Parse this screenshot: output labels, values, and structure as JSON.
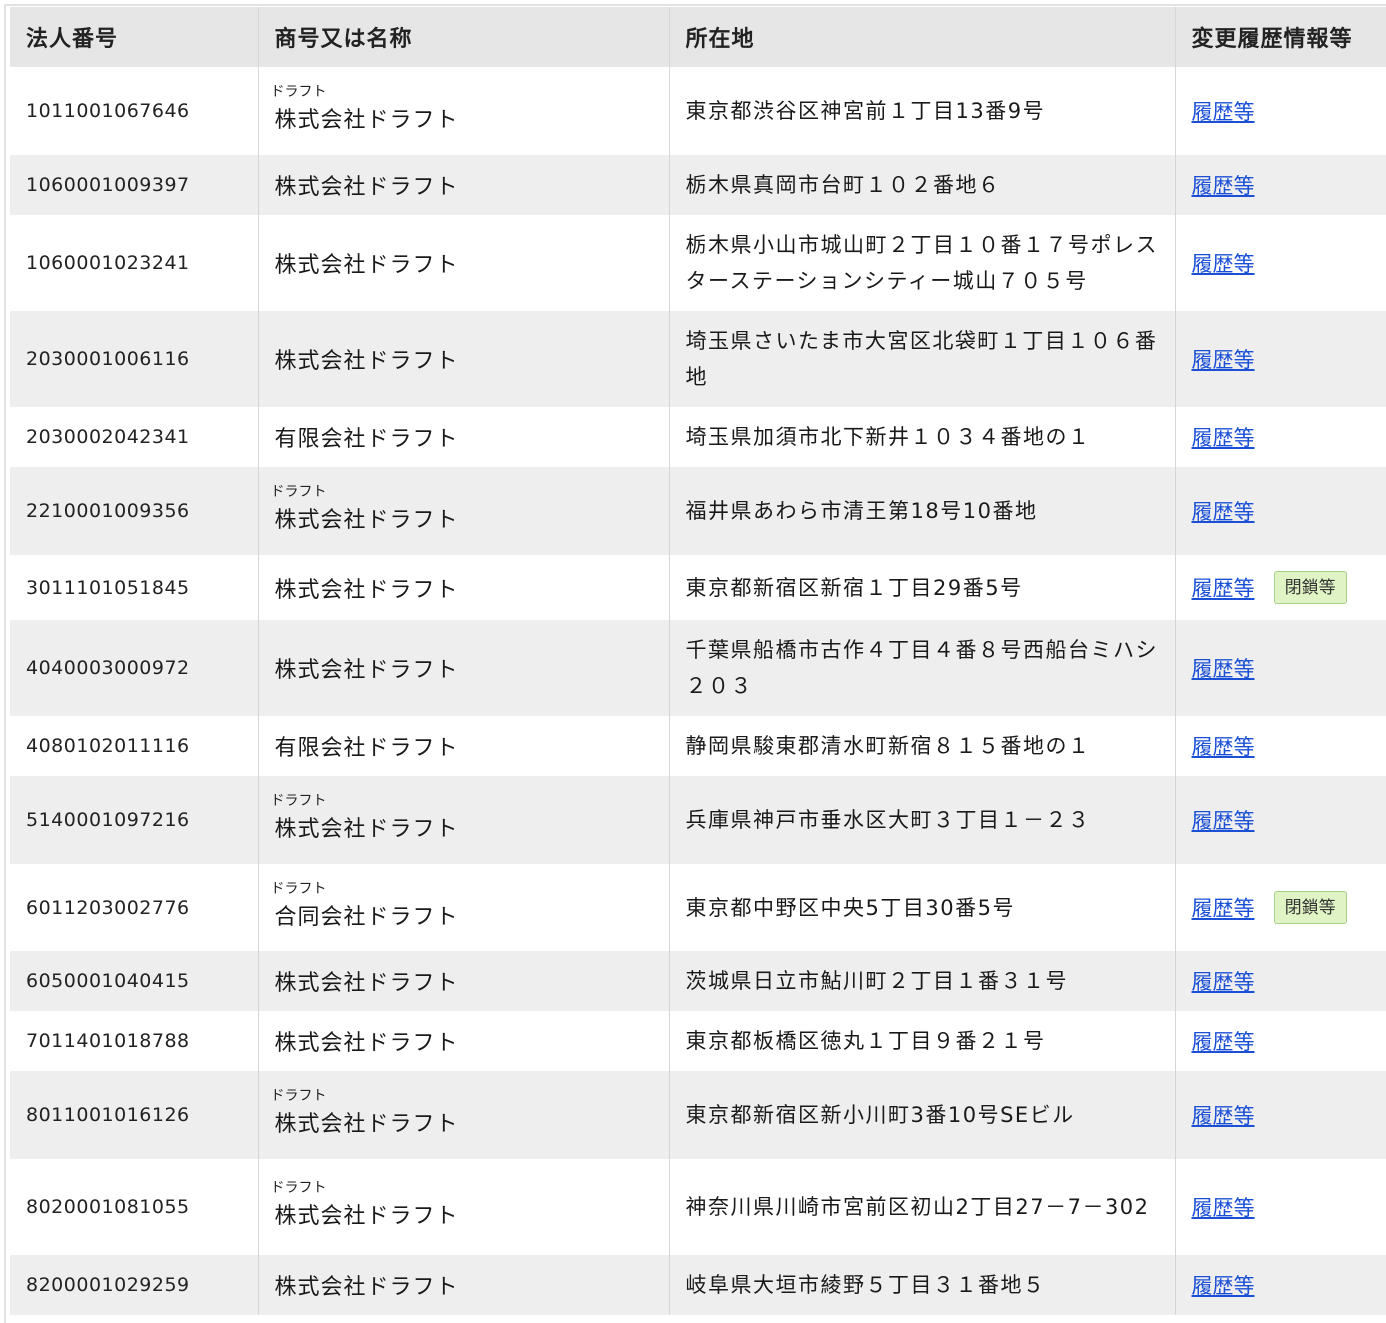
{
  "headers": {
    "corp_number": "法人番号",
    "name": "商号又は名称",
    "address": "所在地",
    "history": "変更履歴情報等"
  },
  "history_link_label": "履歴等",
  "closed_label": "閉鎖等",
  "rows": [
    {
      "number": "1011001067646",
      "furigana": "ドラフト",
      "name": "株式会社ドラフト",
      "address": "東京都渋谷区神宮前１丁目13番9号",
      "closed": false
    },
    {
      "number": "1060001009397",
      "furigana": "",
      "name": "株式会社ドラフト",
      "address": "栃木県真岡市台町１０２番地６",
      "closed": false
    },
    {
      "number": "1060001023241",
      "furigana": "",
      "name": "株式会社ドラフト",
      "address": "栃木県小山市城山町２丁目１０番１７号ポレスターステーションシティー城山７０５号",
      "closed": false
    },
    {
      "number": "2030001006116",
      "furigana": "",
      "name": "株式会社ドラフト",
      "address": "埼玉県さいたま市大宮区北袋町１丁目１０６番地",
      "closed": false
    },
    {
      "number": "2030002042341",
      "furigana": "",
      "name": "有限会社ドラフト",
      "address": "埼玉県加須市北下新井１０３４番地の１",
      "closed": false
    },
    {
      "number": "2210001009356",
      "furigana": "ドラフト",
      "name": "株式会社ドラフト",
      "address": "福井県あわら市清王第18号10番地",
      "closed": false
    },
    {
      "number": "3011101051845",
      "furigana": "",
      "name": "株式会社ドラフト",
      "address": "東京都新宿区新宿１丁目29番5号",
      "closed": true
    },
    {
      "number": "4040003000972",
      "furigana": "",
      "name": "株式会社ドラフト",
      "address": "千葉県船橋市古作４丁目４番８号西船台ミハシ２０３",
      "closed": false
    },
    {
      "number": "4080102011116",
      "furigana": "",
      "name": "有限会社ドラフト",
      "address": "静岡県駿東郡清水町新宿８１５番地の１",
      "closed": false
    },
    {
      "number": "5140001097216",
      "furigana": "ドラフト",
      "name": "株式会社ドラフト",
      "address": "兵庫県神戸市垂水区大町３丁目１－２３",
      "closed": false
    },
    {
      "number": "6011203002776",
      "furigana": "ドラフト",
      "name": "合同会社ドラフト",
      "address": "東京都中野区中央5丁目30番5号",
      "closed": true
    },
    {
      "number": "6050001040415",
      "furigana": "",
      "name": "株式会社ドラフト",
      "address": "茨城県日立市鮎川町２丁目１番３１号",
      "closed": false
    },
    {
      "number": "7011401018788",
      "furigana": "",
      "name": "株式会社ドラフト",
      "address": "東京都板橋区徳丸１丁目９番２１号",
      "closed": false
    },
    {
      "number": "8011001016126",
      "furigana": "ドラフト",
      "name": "株式会社ドラフト",
      "address": "東京都新宿区新小川町3番10号SEビル",
      "closed": false
    },
    {
      "number": "8020001081055",
      "furigana": "ドラフト",
      "name": "株式会社ドラフト",
      "address": "神奈川県川崎市宮前区初山2丁目27－7－302",
      "closed": false
    },
    {
      "number": "8200001029259",
      "furigana": "",
      "name": "株式会社ドラフト",
      "address": "岐阜県大垣市綾野５丁目３１番地５",
      "closed": false
    }
  ]
}
